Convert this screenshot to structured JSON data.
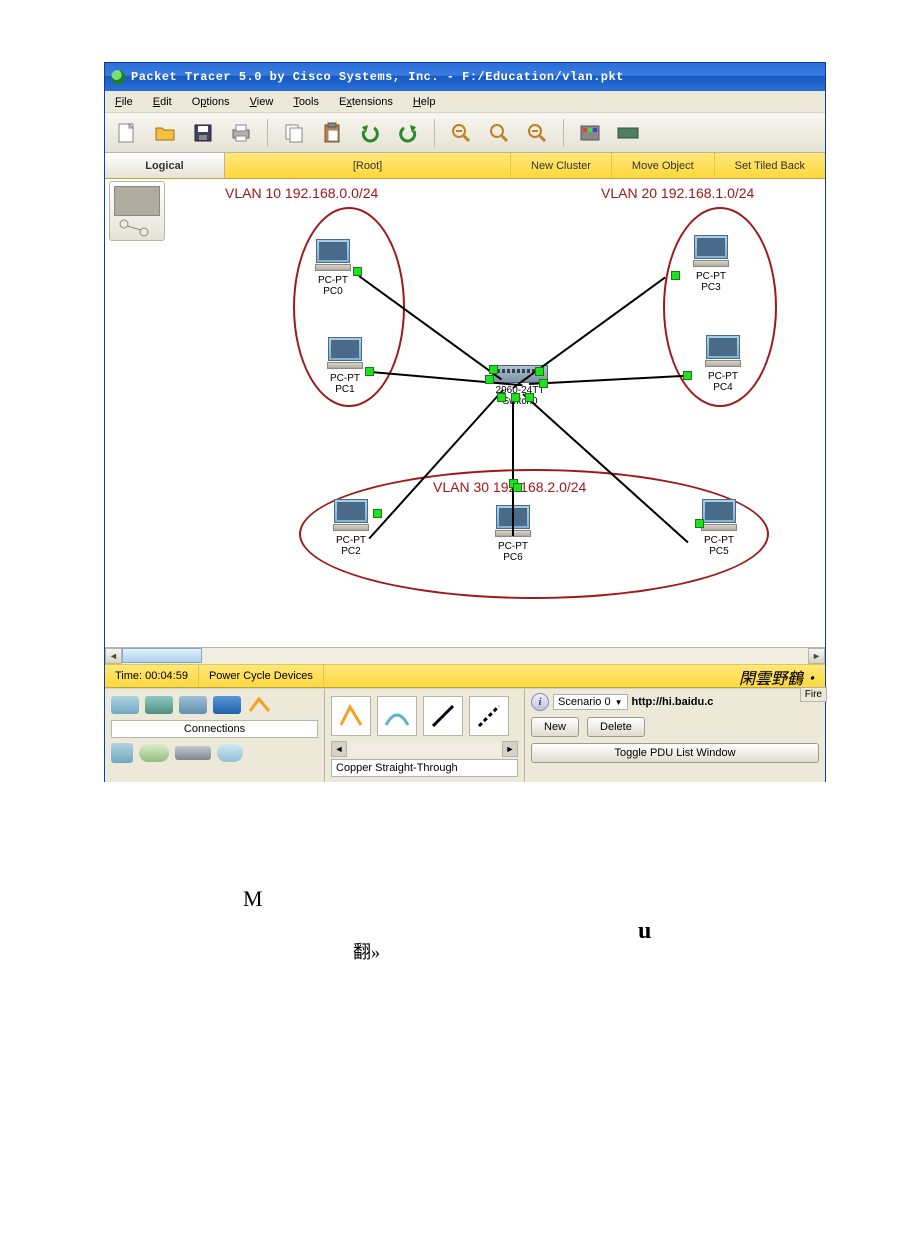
{
  "window": {
    "title": "Packet Tracer 5.0 by Cisco Systems, Inc. - F:/Education/vlan.pkt"
  },
  "menu": {
    "file": "File",
    "edit": "Edit",
    "options": "Options",
    "view": "View",
    "tools": "Tools",
    "extensions": "Extensions",
    "help": "Help"
  },
  "secondary": {
    "logical": "Logical",
    "root": "[Root]",
    "new_cluster": "New Cluster",
    "move_object": "Move Object",
    "set_tiled": "Set Tiled Back"
  },
  "vlans": {
    "v10": "VLAN 10 192.168.0.0/24",
    "v20": "VLAN 20 192.168.1.0/24",
    "v30": "VLAN 30 192.168.2.0/24"
  },
  "devices": {
    "pc0": {
      "type": "PC-PT",
      "name": "PC0"
    },
    "pc1": {
      "type": "PC-PT",
      "name": "PC1"
    },
    "pc2": {
      "type": "PC-PT",
      "name": "PC2"
    },
    "pc3": {
      "type": "PC-PT",
      "name": "PC3"
    },
    "pc4": {
      "type": "PC-PT",
      "name": "PC4"
    },
    "pc5": {
      "type": "PC-PT",
      "name": "PC5"
    },
    "pc6": {
      "type": "PC-PT",
      "name": "PC6"
    },
    "switch0": {
      "type": "2960-24TT",
      "name": "Switch0"
    }
  },
  "status": {
    "time": "Time: 00:04:59",
    "power_cycle": "Power Cycle Devices",
    "watermark": "閑雲野鶴・"
  },
  "bottom": {
    "connections_label": "Connections",
    "conn_type": "Copper Straight-Through",
    "scenario": "Scenario 0",
    "url_hint": "http://hi.baidu.c",
    "fire": "Fire",
    "new": "New",
    "delete": "Delete",
    "toggle_pdu": "Toggle PDU List Window"
  },
  "extra": {
    "m": "M",
    "fan": "翻»",
    "u": "u"
  }
}
